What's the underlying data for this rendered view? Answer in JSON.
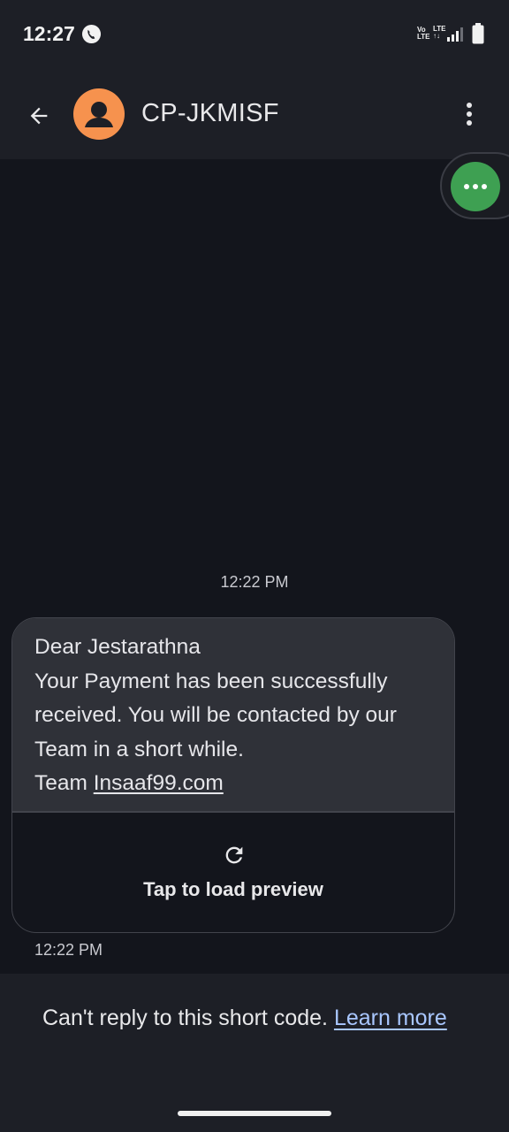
{
  "status_bar": {
    "time": "12:27",
    "net_label_1": "Vo\nLTE",
    "net_label_2": "LTE\n↑↓"
  },
  "header": {
    "contact_name": "CP-JKMISF"
  },
  "thread": {
    "timestamp_top": "12:22 PM",
    "message": {
      "line1": "Dear Jestarathna",
      "line2": "Your Payment has been successfully received. You will be contacted by our Team in a short while.",
      "line3_prefix": "Team ",
      "link_text": "Insaaf99.com"
    },
    "preview_label": "Tap to load preview",
    "timestamp_bottom": "12:22 PM"
  },
  "footer": {
    "text": "Can't reply to this short code. ",
    "link_text": "Learn more"
  },
  "colors": {
    "background": "#13151c",
    "avatar": "#f6924e",
    "fab": "#3ea052",
    "link": "#a9c7ff"
  },
  "icons": {
    "back": "arrow-left-icon",
    "menu": "more-vert-icon",
    "fab": "more-horiz-icon",
    "refresh": "refresh-icon"
  }
}
